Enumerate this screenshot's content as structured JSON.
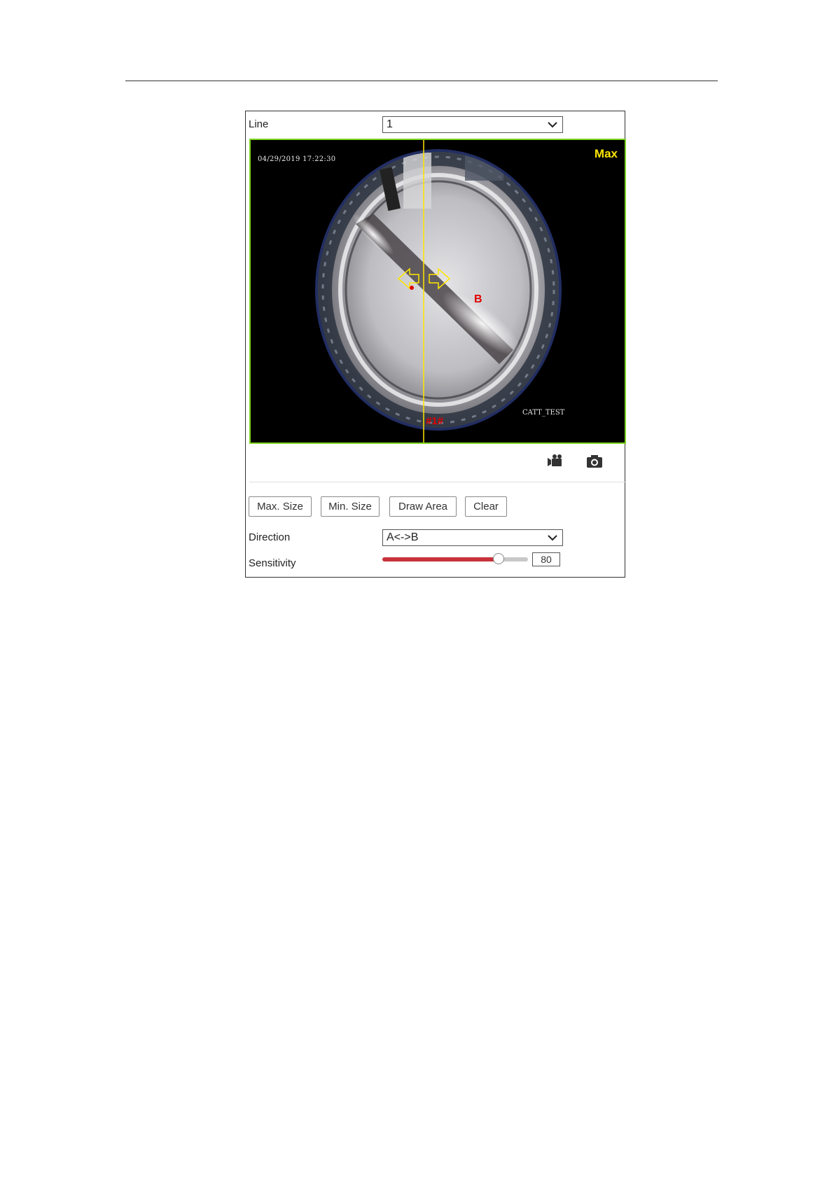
{
  "line": {
    "label": "Line",
    "selected": "1"
  },
  "video": {
    "osd_datetime": "04/29/2019 17:22:30",
    "osd_camera_name": "CATT_TEST",
    "size_mode": "Max",
    "line_tag": "#1#",
    "side_label": "B",
    "overlay_color": "#ffe600",
    "frame_color": "#7ed321",
    "label_color": "#e00000"
  },
  "toolbar": {
    "record_icon": "video-record-icon",
    "snapshot_icon": "camera-snapshot-icon"
  },
  "buttons": {
    "max_size": "Max. Size",
    "min_size": "Min. Size",
    "draw_area": "Draw Area",
    "clear": "Clear"
  },
  "direction": {
    "label": "Direction",
    "selected": "A<->B"
  },
  "sensitivity": {
    "label": "Sensitivity",
    "value": "80",
    "level": 0.8,
    "fill_color": "#c8323a"
  }
}
